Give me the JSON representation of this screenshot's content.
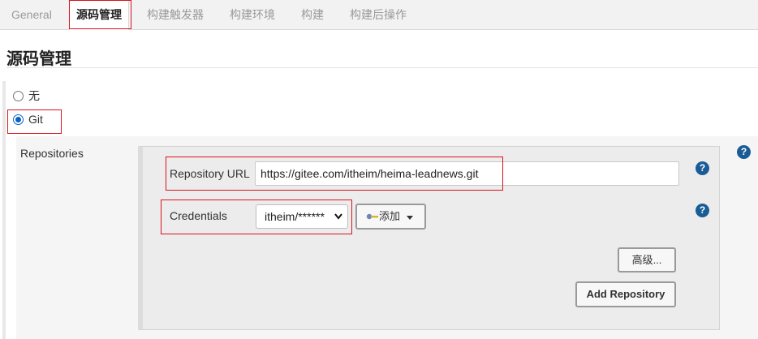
{
  "tabs": [
    {
      "label": "General"
    },
    {
      "label": "源码管理"
    },
    {
      "label": "构建触发器"
    },
    {
      "label": "构建环境"
    },
    {
      "label": "构建"
    },
    {
      "label": "构建后操作"
    }
  ],
  "section": {
    "title": "源码管理"
  },
  "scm_options": {
    "none_label": "无",
    "git_label": "Git",
    "selected": "Git"
  },
  "repositories": {
    "label": "Repositories",
    "url_label": "Repository URL",
    "url_value": "https://gitee.com/itheim/heima-leadnews.git",
    "credentials_label": "Credentials",
    "credentials_value": "itheim/******",
    "add_label": "添加",
    "advanced_label": "高级...",
    "add_repository_label": "Add Repository"
  },
  "help": {
    "glyph": "?"
  },
  "colors": {
    "highlight_box": "#d9141e",
    "help_icon": "#1a5c96",
    "radio_checked": "#0a62c8"
  }
}
